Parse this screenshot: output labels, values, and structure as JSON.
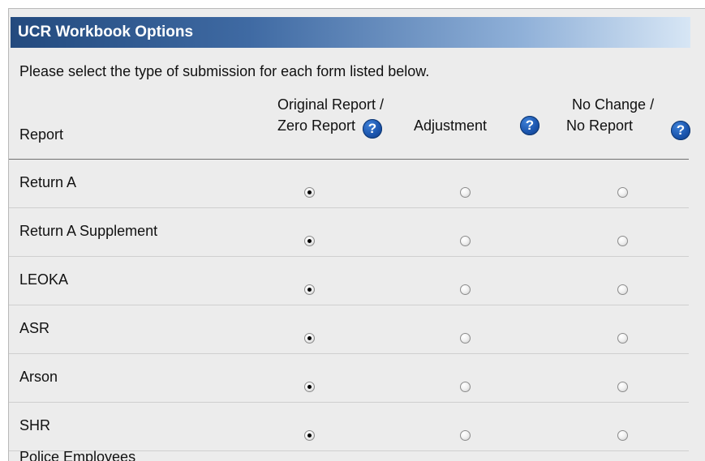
{
  "window": {
    "title": "UCR Workbook Options"
  },
  "instructions": "Please select the type of submission for each form listed below.",
  "columns": {
    "report": "Report",
    "original_line1": "Original Report /",
    "original_line2": "Zero Report",
    "adjustment": "Adjustment",
    "nochange_line1": "No Change /",
    "nochange_line2": "No Report",
    "help_glyph": "?"
  },
  "icons": {
    "help": "help-question-icon",
    "help_color": "#1c56ae",
    "title_bar_color": "#234a7e"
  },
  "rows": [
    {
      "label": "Return A",
      "selected": "original"
    },
    {
      "label": "Return A Supplement",
      "selected": "original"
    },
    {
      "label": "LEOKA",
      "selected": "original"
    },
    {
      "label": "ASR",
      "selected": "original"
    },
    {
      "label": "Arson",
      "selected": "original"
    },
    {
      "label": "SHR",
      "selected": "original"
    }
  ],
  "partial_row_label": "Police Employees"
}
